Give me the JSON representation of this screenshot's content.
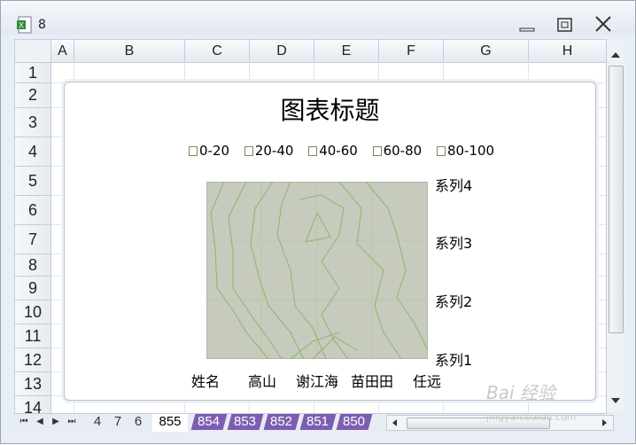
{
  "window": {
    "title": "8"
  },
  "columns": [
    "A",
    "B",
    "C",
    "D",
    "E",
    "F",
    "G",
    "H"
  ],
  "rows": [
    "1",
    "2",
    "3",
    "4",
    "5",
    "6",
    "7",
    "8",
    "9",
    "10",
    "11",
    "12",
    "13",
    "14"
  ],
  "chart": {
    "title": "图表标题",
    "legend": [
      "0-20",
      "20-40",
      "40-60",
      "60-80",
      "80-100"
    ],
    "series_labels": [
      "系列4",
      "系列3",
      "系列2",
      "系列1"
    ],
    "categories": [
      "姓名",
      "高山",
      "谢江海",
      "苗田田",
      "任远"
    ]
  },
  "chart_data": {
    "type": "heatmap",
    "title": "图表标题",
    "categories": [
      "姓名",
      "高山",
      "谢江海",
      "苗田田",
      "任远"
    ],
    "series": [
      {
        "name": "系列1"
      },
      {
        "name": "系列2"
      },
      {
        "name": "系列3"
      },
      {
        "name": "系列4"
      }
    ],
    "legend_bands": [
      "0-20",
      "20-40",
      "40-60",
      "60-80",
      "80-100"
    ],
    "legend_position": "top"
  },
  "sheets": {
    "plain": [
      "4",
      "7",
      "6"
    ],
    "active": "855",
    "purple": [
      "854",
      "853",
      "852",
      "851",
      "850"
    ]
  },
  "watermark": "Bai 经验",
  "watermark_sub": "jingyan.baidu.com",
  "colors": {
    "plot_bg": "#c6cbbd",
    "contour": "#8db56a",
    "tab_purple": "#7d5db1"
  }
}
